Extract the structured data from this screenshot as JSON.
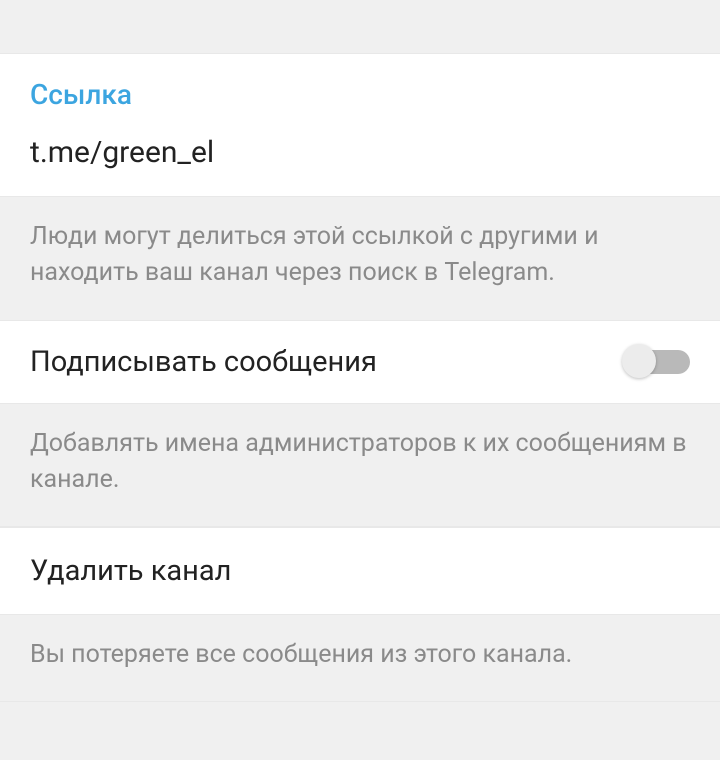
{
  "link_section": {
    "header": "Ссылка",
    "value": "t.me/green_el",
    "description": "Люди могут делиться этой ссылкой с другими и находить ваш канал через поиск в Telegram."
  },
  "sign_messages": {
    "label": "Подписывать сообщения",
    "enabled": false,
    "description": "Добавлять имена администраторов к их сообщениям в канале."
  },
  "delete_channel": {
    "label": "Удалить канал",
    "description": "Вы потеряете все сообщения из этого канала."
  }
}
